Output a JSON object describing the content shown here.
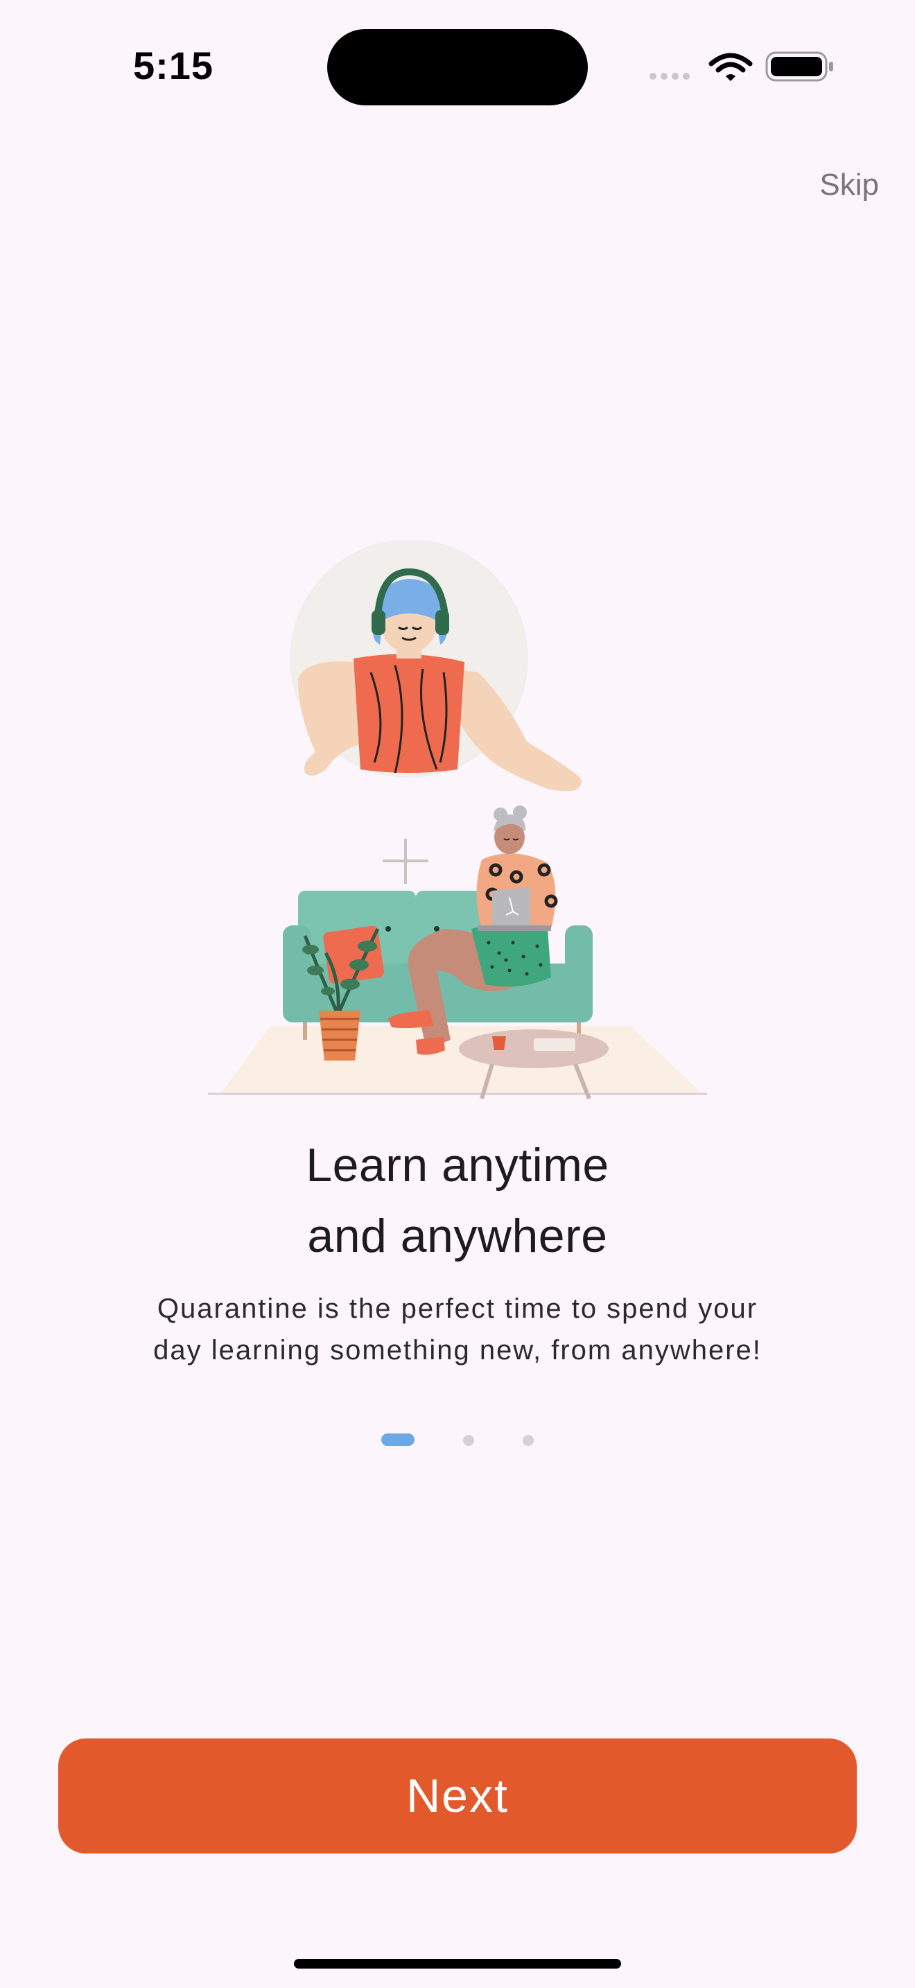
{
  "status_bar": {
    "time": "5:15",
    "icons": [
      "cellular-signal-icon",
      "wifi-icon",
      "battery-icon"
    ]
  },
  "onboarding": {
    "skip_label": "Skip",
    "illustration": "woman-with-headphones-and-woman-on-sofa-with-laptop",
    "title_line1": "Learn anytime",
    "title_line2": "and anywhere",
    "subtitle_line1": "Quarantine is the perfect time to spend your",
    "subtitle_line2": "day learning something new, from anywhere!",
    "page_indicator": {
      "total": 3,
      "current": 1
    },
    "next_label": "Next"
  },
  "colors": {
    "background": "#fcf6fc",
    "accent": "#e25a2c",
    "active_dot": "#6da8e6",
    "inactive_dot": "#d4d0d6"
  }
}
